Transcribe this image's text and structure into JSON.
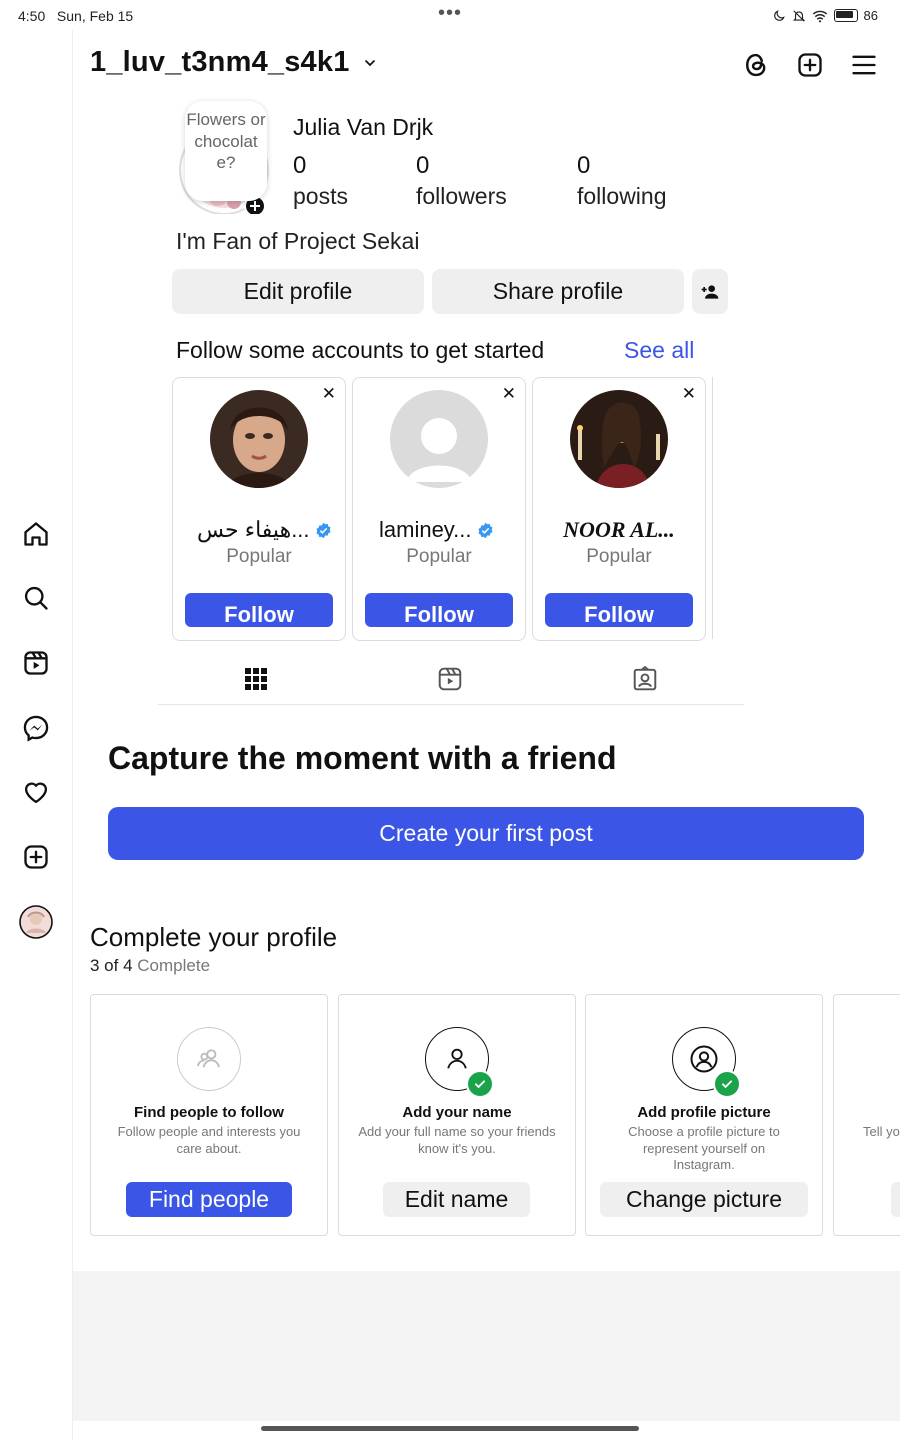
{
  "status_bar": {
    "time": "4:50",
    "date": "Sun, Feb 15",
    "dots": "•••",
    "battery": "86"
  },
  "header": {
    "username": "1_luv_t3nm4_s4k1"
  },
  "profile": {
    "note": "Flowers or chocolate?",
    "full_name": "Julia Van Drjk",
    "stats": [
      {
        "num": "0",
        "label": "posts"
      },
      {
        "num": "0",
        "label": "followers"
      },
      {
        "num": "0",
        "label": "following"
      }
    ],
    "bio": "I'm Fan of Project Sekai",
    "edit_label": "Edit profile",
    "share_label": "Share profile"
  },
  "suggestions": {
    "title": "Follow some accounts to get started",
    "see_all": "See all",
    "cards": [
      {
        "name": "هيفاء حس...",
        "sub": "Popular",
        "follow": "Follow"
      },
      {
        "name": "laminey...",
        "sub": "Popular",
        "follow": "Follow"
      },
      {
        "name": "NOOR AL...",
        "sub": "Popular",
        "follow": "Follow"
      }
    ]
  },
  "capture": {
    "title": "Capture the moment with a friend",
    "button": "Create your first post"
  },
  "complete_profile": {
    "title": "Complete your profile",
    "progress": "3 of 4",
    "progress_word": "Complete",
    "cards": [
      {
        "title": "Find people to follow",
        "desc": "Follow people and interests you care about.",
        "button": "Find people"
      },
      {
        "title": "Add your name",
        "desc": "Add your full name so your friends know it's you.",
        "button": "Edit name"
      },
      {
        "title": "Add profile picture",
        "desc": "Choose a profile picture to represent yourself on Instagram.",
        "button": "Change picture"
      },
      {
        "desc": "Tell yo"
      }
    ]
  },
  "colors": {
    "accent": "#3b55e6",
    "check": "#1aa34a"
  }
}
